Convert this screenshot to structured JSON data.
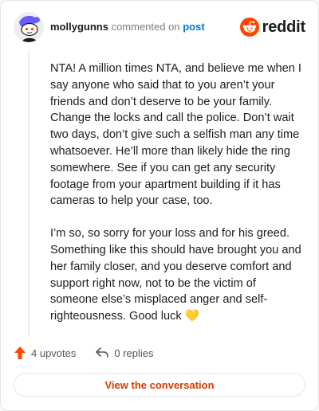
{
  "header": {
    "username": "mollygunns",
    "commented_text": "commented on",
    "post_link": "post",
    "logo_text": "reddit"
  },
  "comment": {
    "paragraphs": [
      "NTA! A million times NTA, and believe me when I say anyone who said that to you aren’t your friends and don’t deserve to be your family. Change the locks and call the police. Don’t wait two days, don’t give such a selfish man any time whatsoever. He’ll more than likely hide the ring somewhere. See if you can get any security footage from your apartment building if it has cameras to help your case, too.",
      "I’m so, so sorry for your loss and for his greed. Something like this should have brought you and her family closer, and you deserve comfort and support right now, not to be the victim of someone else’s misplaced anger and self-righteousness. Good luck 💛"
    ]
  },
  "actions": {
    "upvotes": "4 upvotes",
    "replies": "0 replies"
  },
  "cta": {
    "label": "View the conversation"
  },
  "colors": {
    "reddit_orange": "#ff4500",
    "link_blue": "#0079d3",
    "cta_text": "#d93a00",
    "avatar_purple": "#6a5cff"
  },
  "icons": {
    "avatar": "snoo-avatar-icon",
    "logo": "reddit-logo-icon",
    "upvote": "upvote-arrow-icon",
    "reply": "reply-arrow-icon"
  }
}
